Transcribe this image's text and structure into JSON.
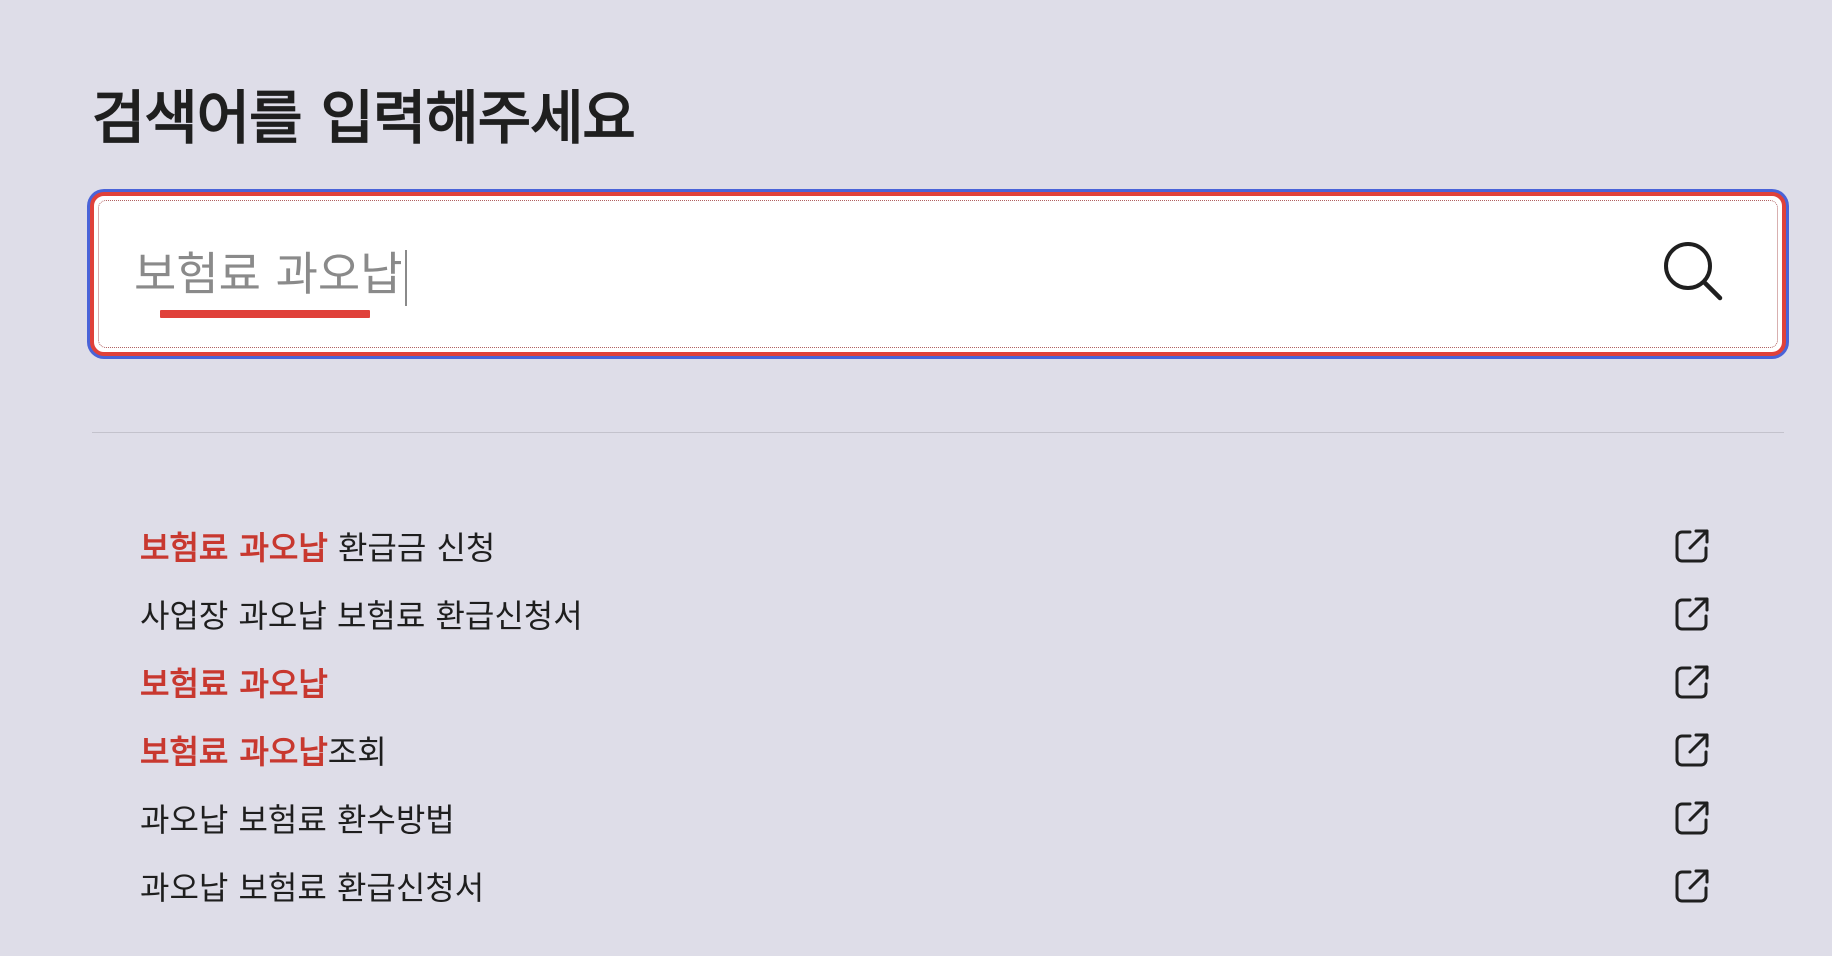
{
  "page": {
    "title": "검색어를 입력해주세요"
  },
  "search": {
    "value": "보험료 과오납",
    "icon": "search-icon",
    "colors": {
      "border": "#e0413a",
      "focus_ring": "#4a63d8",
      "ime_underline": "#e0413a"
    }
  },
  "results": [
    {
      "match": "보험료 과오납",
      "rest": " 환급금 신청",
      "icon": "external-link-icon"
    },
    {
      "match": "",
      "rest": "사업장 과오납 보험료 환급신청서",
      "icon": "external-link-icon"
    },
    {
      "match": "보험료 과오납",
      "rest": "",
      "icon": "external-link-icon"
    },
    {
      "match": "보험료 과오납",
      "rest": "조회",
      "icon": "external-link-icon"
    },
    {
      "match": "",
      "rest": "과오납 보험료 환수방법",
      "icon": "external-link-icon"
    },
    {
      "match": "",
      "rest": "과오납 보험료 환급신청서",
      "icon": "external-link-icon"
    }
  ],
  "colors": {
    "background": "#dedde8",
    "highlight": "#c8382f"
  }
}
